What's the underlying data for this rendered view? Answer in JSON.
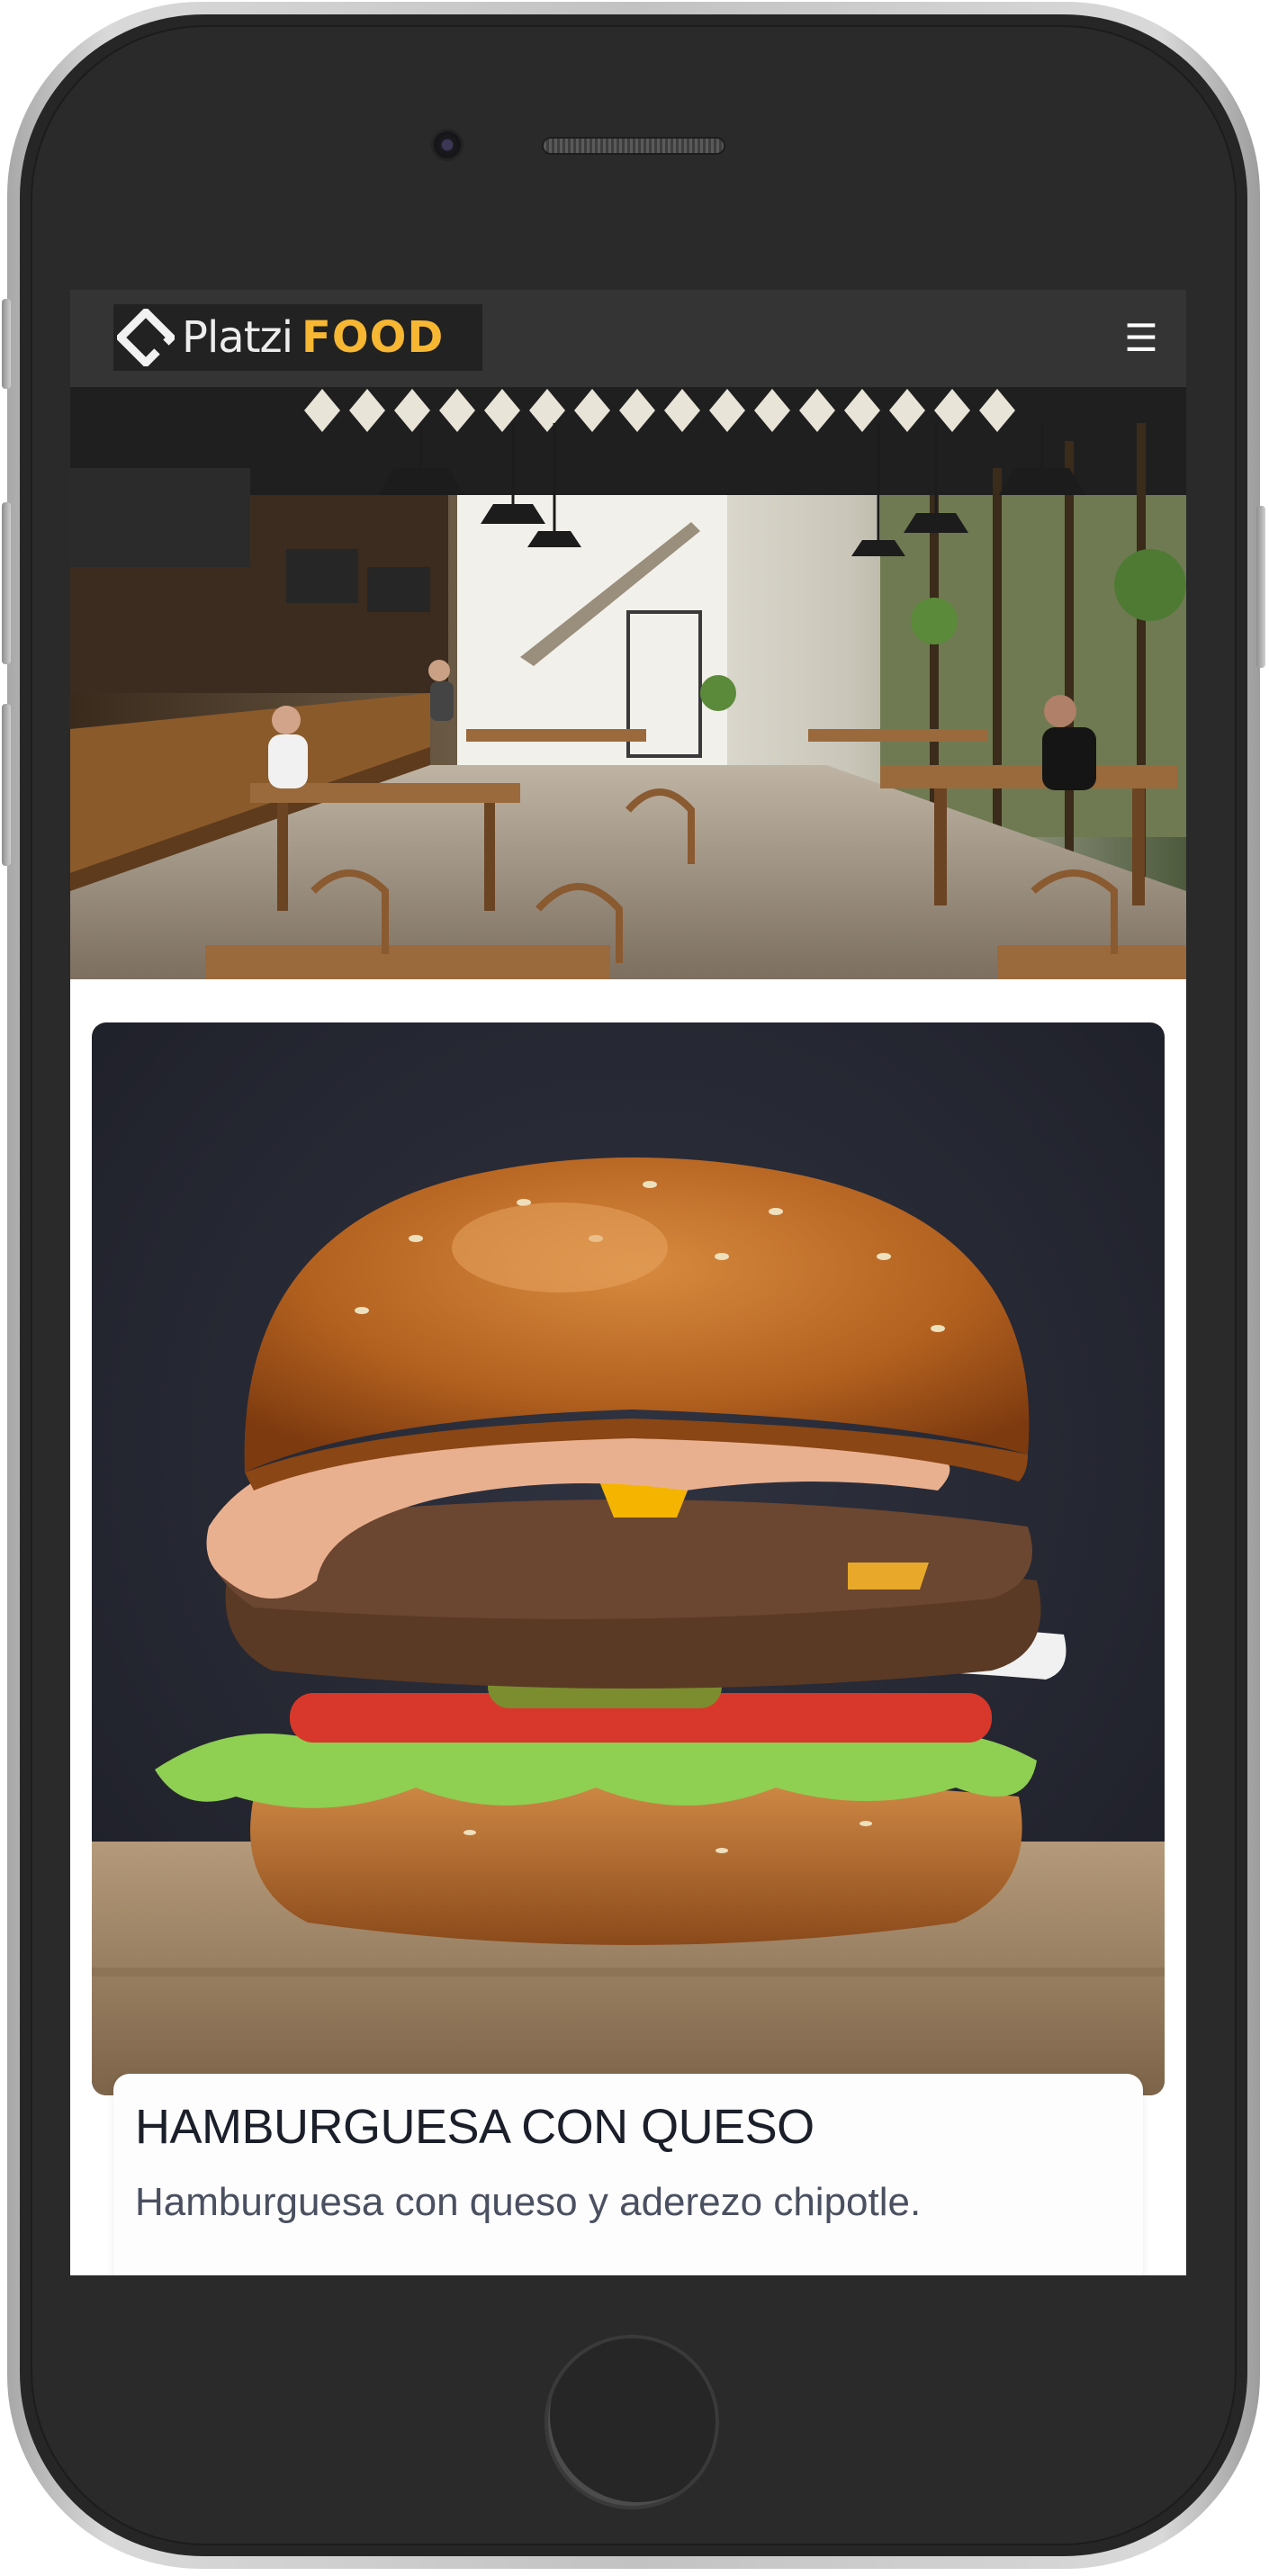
{
  "navbar": {
    "logo_word_a": "Platzi",
    "logo_word_b": "FOOD",
    "menu_icon": "hamburger-menu-icon",
    "menu_glyph": "☰"
  },
  "hero": {
    "image_subject": "restaurant-interior"
  },
  "card": {
    "image_subject": "cheeseburger",
    "title": "HAMBURGUESA CON QUESO",
    "text": "Hamburguesa con queso y aderezo chipotle."
  },
  "colors": {
    "navbar_bg": "#343434",
    "logo_accent": "#f7b733",
    "title_text": "#1b1f2a",
    "body_text": "#4a5060"
  }
}
